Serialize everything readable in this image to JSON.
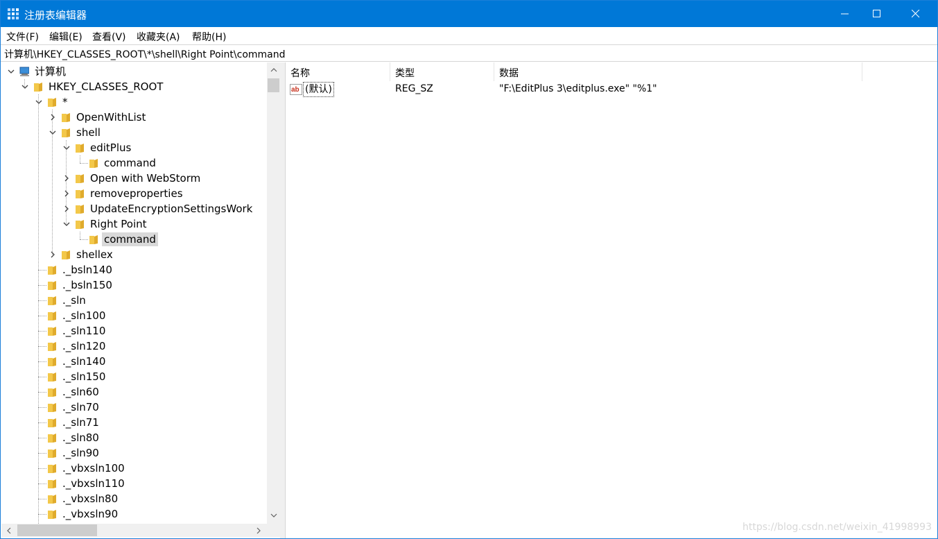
{
  "window": {
    "title": "注册表编辑器",
    "controls": {
      "minimize": "—",
      "maximize": "☐",
      "close": "✕"
    }
  },
  "menu": [
    {
      "label": "文件(F)"
    },
    {
      "label": "编辑(E)"
    },
    {
      "label": "查看(V)"
    },
    {
      "label": "收藏夹(A)"
    },
    {
      "label": "帮助(H)"
    }
  ],
  "address": "计算机\\HKEY_CLASSES_ROOT\\*\\shell\\Right Point\\command",
  "tree": [
    {
      "label": "计算机",
      "level": 0,
      "expander": "expanded",
      "icon": "computer-icon"
    },
    {
      "label": "HKEY_CLASSES_ROOT",
      "level": 1,
      "expander": "expanded",
      "icon": "folder-icon"
    },
    {
      "label": "*",
      "level": 2,
      "expander": "expanded",
      "icon": "folder-icon"
    },
    {
      "label": "OpenWithList",
      "level": 3,
      "expander": "collapsed",
      "icon": "folder-icon"
    },
    {
      "label": "shell",
      "level": 3,
      "expander": "expanded",
      "icon": "folder-icon"
    },
    {
      "label": "editPlus",
      "level": 4,
      "expander": "expanded",
      "icon": "folder-icon"
    },
    {
      "label": "command",
      "level": 5,
      "expander": "none",
      "icon": "folder-icon"
    },
    {
      "label": "Open with WebStorm",
      "level": 4,
      "expander": "collapsed",
      "icon": "folder-icon"
    },
    {
      "label": "removeproperties",
      "level": 4,
      "expander": "collapsed",
      "icon": "folder-icon"
    },
    {
      "label": "UpdateEncryptionSettingsWork",
      "level": 4,
      "expander": "collapsed",
      "icon": "folder-icon"
    },
    {
      "label": "Right Point",
      "level": 4,
      "expander": "expanded",
      "icon": "folder-icon"
    },
    {
      "label": "command",
      "level": 5,
      "expander": "none",
      "icon": "folder-icon",
      "selected": true
    },
    {
      "label": "shellex",
      "level": 3,
      "expander": "collapsed",
      "icon": "folder-icon"
    },
    {
      "label": "._bsln140",
      "level": 2,
      "expander": "none",
      "icon": "folder-icon"
    },
    {
      "label": "._bsln150",
      "level": 2,
      "expander": "none",
      "icon": "folder-icon"
    },
    {
      "label": "._sln",
      "level": 2,
      "expander": "none",
      "icon": "folder-icon"
    },
    {
      "label": "._sln100",
      "level": 2,
      "expander": "none",
      "icon": "folder-icon"
    },
    {
      "label": "._sln110",
      "level": 2,
      "expander": "none",
      "icon": "folder-icon"
    },
    {
      "label": "._sln120",
      "level": 2,
      "expander": "none",
      "icon": "folder-icon"
    },
    {
      "label": "._sln140",
      "level": 2,
      "expander": "none",
      "icon": "folder-icon"
    },
    {
      "label": "._sln150",
      "level": 2,
      "expander": "none",
      "icon": "folder-icon"
    },
    {
      "label": "._sln60",
      "level": 2,
      "expander": "none",
      "icon": "folder-icon"
    },
    {
      "label": "._sln70",
      "level": 2,
      "expander": "none",
      "icon": "folder-icon"
    },
    {
      "label": "._sln71",
      "level": 2,
      "expander": "none",
      "icon": "folder-icon"
    },
    {
      "label": "._sln80",
      "level": 2,
      "expander": "none",
      "icon": "folder-icon"
    },
    {
      "label": "._sln90",
      "level": 2,
      "expander": "none",
      "icon": "folder-icon"
    },
    {
      "label": "._vbxsln100",
      "level": 2,
      "expander": "none",
      "icon": "folder-icon"
    },
    {
      "label": "._vbxsln110",
      "level": 2,
      "expander": "none",
      "icon": "folder-icon"
    },
    {
      "label": "._vbxsln80",
      "level": 2,
      "expander": "none",
      "icon": "folder-icon"
    },
    {
      "label": "._vbxsln90",
      "level": 2,
      "expander": "none",
      "icon": "folder-icon"
    }
  ],
  "list": {
    "columns": [
      {
        "label": "名称"
      },
      {
        "label": "类型"
      },
      {
        "label": "数据"
      }
    ],
    "rows": [
      {
        "name": "(默认)",
        "type": "REG_SZ",
        "data": "\"F:\\EditPlus 3\\editplus.exe\" \"%1\"",
        "icon": "string-value-icon"
      }
    ]
  },
  "watermark": "https://blog.csdn.net/weixin_41998993",
  "colors": {
    "titlebar": "#0078d7",
    "folder": "#f3c84a",
    "selection": "#d9d9d9"
  }
}
